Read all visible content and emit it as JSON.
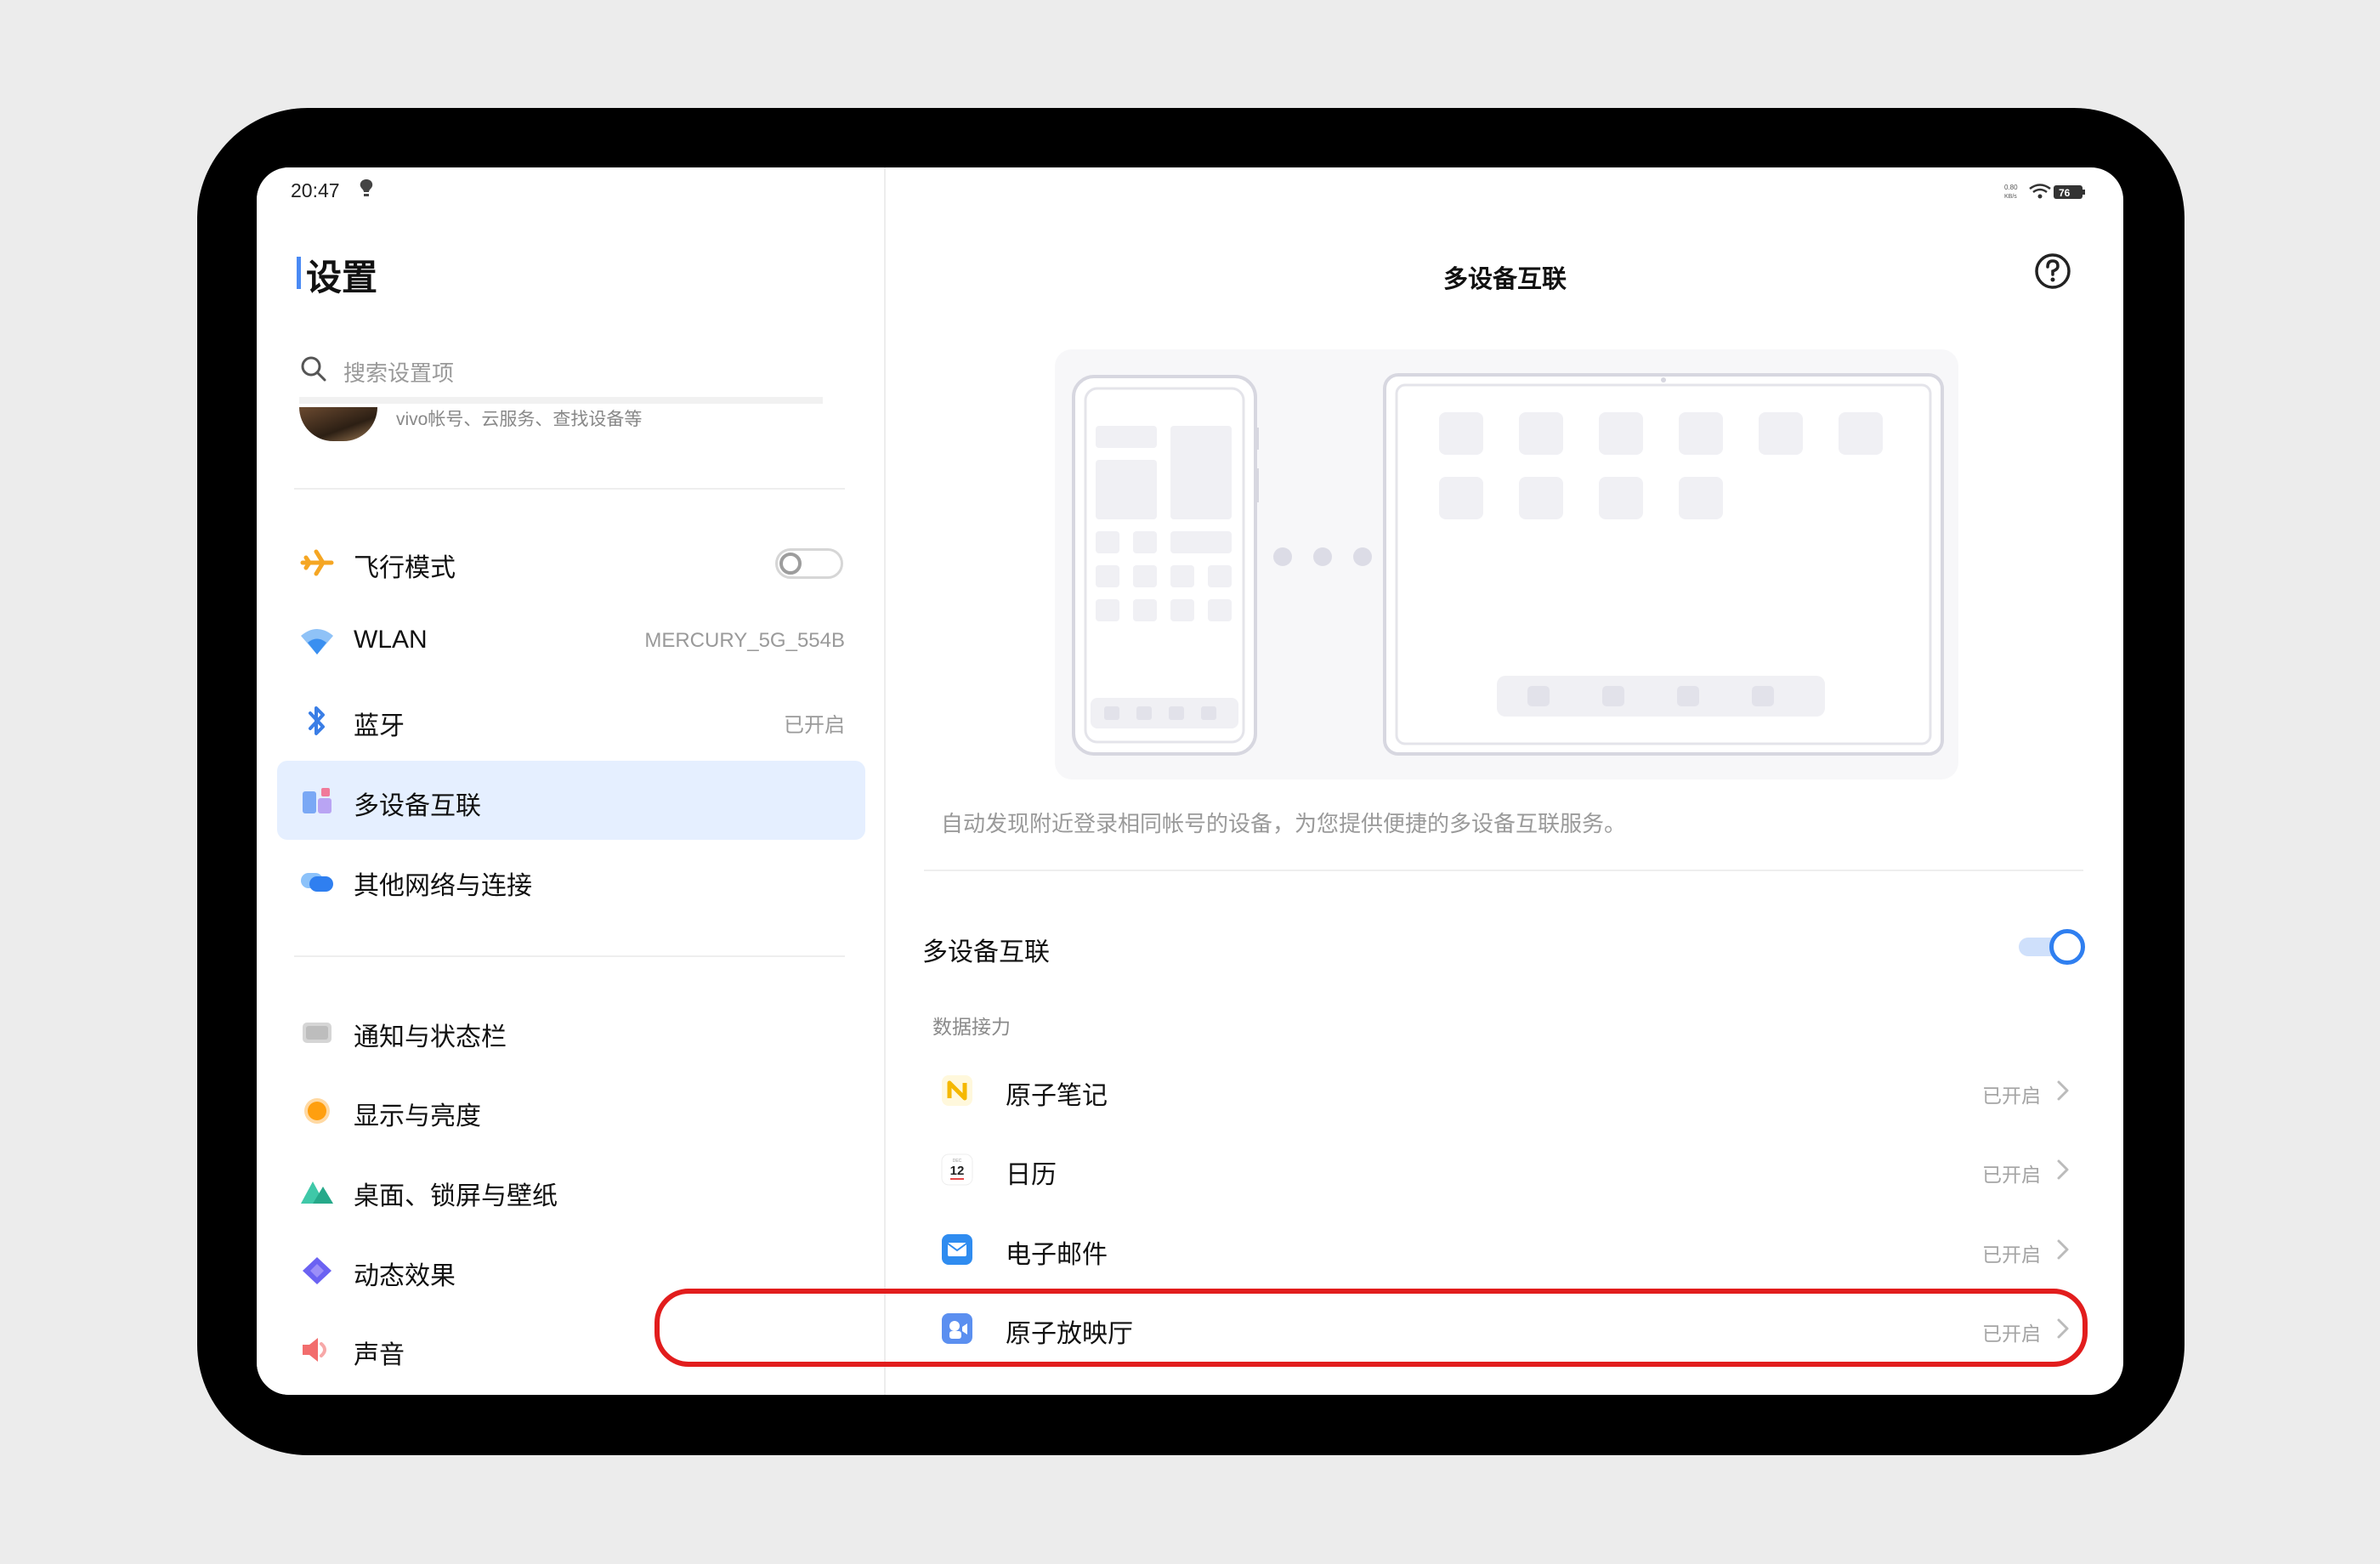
{
  "status_bar": {
    "time": "20:47",
    "net_speed": "0.80 KB/s",
    "battery": "76"
  },
  "sidebar": {
    "title": "设置",
    "search_placeholder": "搜索设置项",
    "account_subtitle": "vivo帐号、云服务、查找设备等",
    "group1": [
      {
        "label": "飞行模式",
        "icon": "airplane-icon",
        "toggle": "off"
      },
      {
        "label": "WLAN",
        "icon": "wifi-icon",
        "value": "MERCURY_5G_554B"
      },
      {
        "label": "蓝牙",
        "icon": "bluetooth-icon",
        "value": "已开启"
      },
      {
        "label": "多设备互联",
        "icon": "multi-device-icon",
        "active": true
      },
      {
        "label": "其他网络与连接",
        "icon": "cloud-network-icon"
      }
    ],
    "group2": [
      {
        "label": "通知与状态栏",
        "icon": "notification-icon"
      },
      {
        "label": "显示与亮度",
        "icon": "brightness-icon"
      },
      {
        "label": "桌面、锁屏与壁纸",
        "icon": "wallpaper-icon"
      },
      {
        "label": "动态效果",
        "icon": "dynamic-effects-icon"
      },
      {
        "label": "声音",
        "icon": "sound-icon"
      }
    ]
  },
  "main": {
    "title": "多设备互联",
    "description": "自动发现附近登录相同帐号的设备，为您提供便捷的多设备互联服务。",
    "toggle_label": "多设备互联",
    "toggle_state": "on",
    "section_label": "数据接力",
    "apps": [
      {
        "label": "原子笔记",
        "value": "已开启",
        "icon": "atom-notes-icon"
      },
      {
        "label": "日历",
        "value": "已开启",
        "icon": "calendar-icon",
        "calendar_day": "12"
      },
      {
        "label": "电子邮件",
        "value": "已开启",
        "icon": "email-icon"
      },
      {
        "label": "原子放映厅",
        "value": "已开启",
        "icon": "atom-theater-icon"
      }
    ]
  },
  "colors": {
    "accent": "#2f7ff0",
    "active_bg": "#e5efff",
    "highlight": "#e21d1d"
  }
}
